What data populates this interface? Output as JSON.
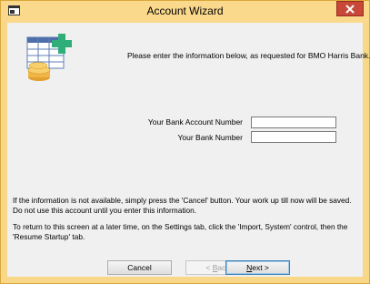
{
  "window": {
    "title": "Account Wizard",
    "colors": {
      "frame": "#f8d888",
      "close": "#c74838",
      "client": "#f0f0f0"
    }
  },
  "header": {
    "intro": "Please enter the information below, as requested for BMO Harris Bank.",
    "logo_icon": "spreadsheet-coins-plus-icon"
  },
  "form": {
    "account_label": "Your Bank Account Number",
    "account_value": "",
    "bank_label": "Your Bank Number",
    "bank_value": ""
  },
  "notes": {
    "cancel_info": "If the information is not available, simply press the 'Cancel' button.  Your work up till now will be saved.  Do not use this account until you enter this information.",
    "return_info": "To return to this screen at a later time, on the Settings tab, click the 'Import, System'  control, then the 'Resume Startup' tab."
  },
  "buttons": {
    "cancel": "Cancel",
    "back_prefix": "< ",
    "back_ul": "B",
    "back_rest": "ack",
    "next_ul": "N",
    "next_rest": "ext >"
  }
}
